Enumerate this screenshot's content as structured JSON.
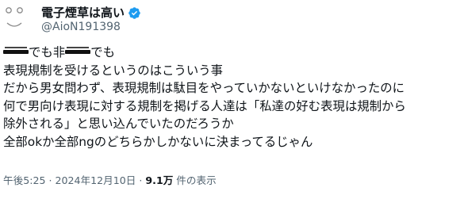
{
  "tweet": {
    "display_name": "電子煙草は高い",
    "handle": "@AioN191398",
    "verified": true,
    "verified_color": "#1d9bf0",
    "lines": [
      {
        "pre": "",
        "post1": "でも非",
        "post2": "でも",
        "redacted": true
      },
      {
        "text": "表現規制を受けるというのはこういう事"
      },
      {
        "text": "だから男女問わず、表現規制は駄目をやっていかないといけなかったのに"
      },
      {
        "text": "何で男向け表現に対する規制を掲げる人達は「私達の好む表現は規制から"
      },
      {
        "text": "除外される」と思い込んでいたのだろうか"
      },
      {
        "text": "全部okか全部ngのどちらかしかないに決まってるじゃん"
      }
    ],
    "time": "午後5:25",
    "separator": " · ",
    "date": "2024年12月10日",
    "views_count": "9.1万",
    "views_label": " 件の表示"
  },
  "icons": {
    "avatar": "avatar-icon",
    "verified": "verified-badge-icon"
  }
}
